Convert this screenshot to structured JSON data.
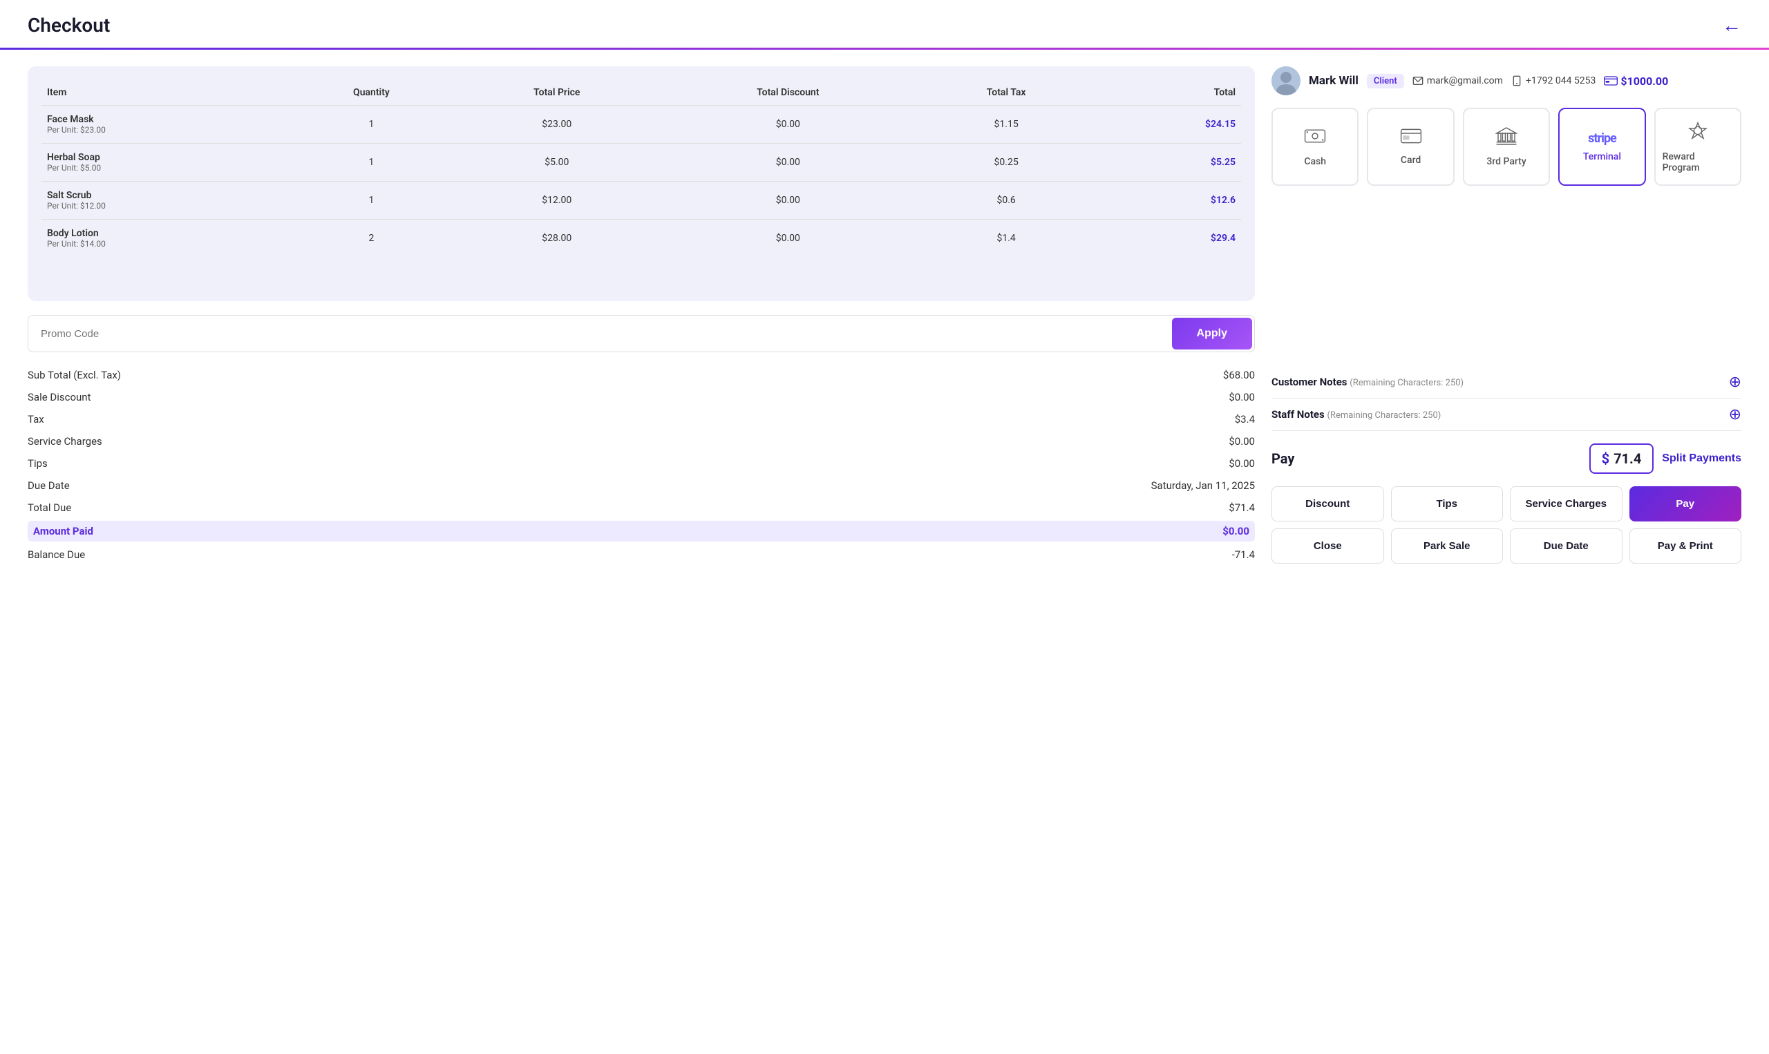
{
  "header": {
    "title": "Checkout",
    "back_label": "←"
  },
  "customer": {
    "name": "Mark Will",
    "badge": "Client",
    "email": "mark@gmail.com",
    "phone": "+1792 044 5253",
    "balance": "$1000.00"
  },
  "payment_methods": [
    {
      "id": "cash",
      "label": "Cash",
      "icon": "cash",
      "active": false
    },
    {
      "id": "card",
      "label": "Card",
      "icon": "card",
      "active": false
    },
    {
      "id": "3rdparty",
      "label": "3rd Party",
      "icon": "bank",
      "active": false
    },
    {
      "id": "terminal",
      "label": "Terminal",
      "icon": "stripe",
      "active": true
    },
    {
      "id": "reward",
      "label": "Reward Program",
      "icon": "reward",
      "active": false
    }
  ],
  "items": [
    {
      "name": "Face Mask",
      "unit": "Per Unit: $23.00",
      "quantity": "1",
      "total_price": "$23.00",
      "total_discount": "$0.00",
      "total_tax": "$1.15",
      "total": "$24.15"
    },
    {
      "name": "Herbal Soap",
      "unit": "Per Unit: $5.00",
      "quantity": "1",
      "total_price": "$5.00",
      "total_discount": "$0.00",
      "total_tax": "$0.25",
      "total": "$5.25"
    },
    {
      "name": "Salt Scrub",
      "unit": "Per Unit: $12.00",
      "quantity": "1",
      "total_price": "$12.00",
      "total_discount": "$0.00",
      "total_tax": "$0.6",
      "total": "$12.6"
    },
    {
      "name": "Body Lotion",
      "unit": "Per Unit: $14.00",
      "quantity": "2",
      "total_price": "$28.00",
      "total_discount": "$0.00",
      "total_tax": "$1.4",
      "total": "$29.4"
    }
  ],
  "table_headers": {
    "item": "Item",
    "quantity": "Quantity",
    "total_price": "Total Price",
    "total_discount": "Total Discount",
    "total_tax": "Total Tax",
    "total": "Total"
  },
  "promo": {
    "placeholder": "Promo Code",
    "apply_label": "Apply"
  },
  "summary": {
    "sub_total_label": "Sub Total (Excl. Tax)",
    "sub_total_value": "$68.00",
    "sale_discount_label": "Sale Discount",
    "sale_discount_value": "$0.00",
    "tax_label": "Tax",
    "tax_value": "$3.4",
    "service_charges_label": "Service Charges",
    "service_charges_value": "$0.00",
    "tips_label": "Tips",
    "tips_value": "$0.00",
    "due_date_label": "Due Date",
    "due_date_value": "Saturday, Jan 11, 2025",
    "total_due_label": "Total Due",
    "total_due_value": "$71.4",
    "amount_paid_label": "Amount Paid",
    "amount_paid_value": "$0.00",
    "balance_due_label": "Balance Due",
    "balance_due_value": "-71.4"
  },
  "notes": {
    "customer_label": "Customer Notes",
    "customer_sub": "(Remaining Characters: 250)",
    "staff_label": "Staff Notes",
    "staff_sub": "(Remaining Characters: 250)"
  },
  "pay": {
    "label": "Pay",
    "amount": "71.4",
    "dollar_sign": "$",
    "split_label": "Split Payments"
  },
  "action_buttons": {
    "discount": "Discount",
    "tips": "Tips",
    "service_charges": "Service Charges",
    "pay": "Pay",
    "close": "Close",
    "park_sale": "Park Sale",
    "due_date": "Due Date",
    "pay_print": "Pay & Print"
  }
}
